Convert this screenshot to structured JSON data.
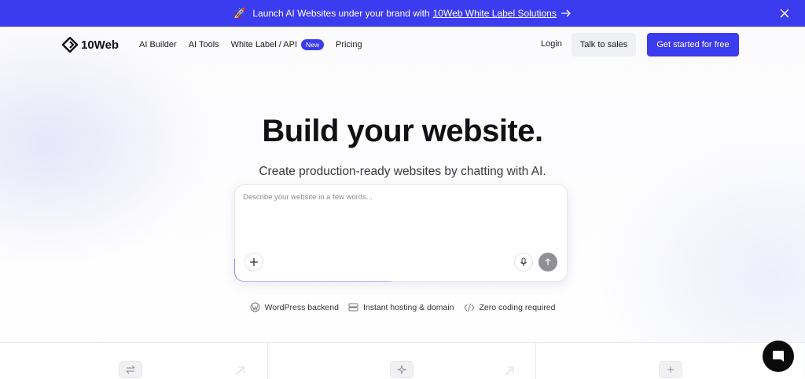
{
  "banner": {
    "text": "Launch AI Websites under your brand with",
    "link_text": "10Web White Label Solutions",
    "rocket_icon": "rocket-icon",
    "arrow_icon": "arrow-right-icon",
    "close_icon": "close-icon",
    "background": "#3b3bf0"
  },
  "nav": {
    "logo_text": "10Web",
    "links": [
      {
        "label": "AI Builder"
      },
      {
        "label": "AI Tools"
      },
      {
        "label": "White Label / API",
        "badge": "New"
      },
      {
        "label": "Pricing"
      }
    ],
    "login": "Login",
    "talk_to_sales": "Talk to sales",
    "get_started": "Get started for free",
    "accent": "#3b3bf0"
  },
  "hero": {
    "title": "Build your website.",
    "subtitle": "Create production-ready websites by chatting with AI."
  },
  "prompt": {
    "placeholder": "Describe your website in a few words...",
    "value": "",
    "add_icon": "plus-icon",
    "mic_icon": "microphone-icon",
    "send_icon": "arrow-up-icon"
  },
  "features": [
    {
      "icon": "wordpress-icon",
      "label": "WordPress backend"
    },
    {
      "icon": "server-icon",
      "label": "Instant hosting & domain"
    },
    {
      "icon": "code-icon",
      "label": "Zero coding required"
    }
  ],
  "cards": [
    {
      "icon": "swap-icon",
      "arrow": "arrow-up-right-icon"
    },
    {
      "icon": "sparkle-icon",
      "arrow": "arrow-up-right-icon"
    },
    {
      "icon": "plus-icon"
    }
  ],
  "chat": {
    "icon": "chat-bubble-icon"
  }
}
